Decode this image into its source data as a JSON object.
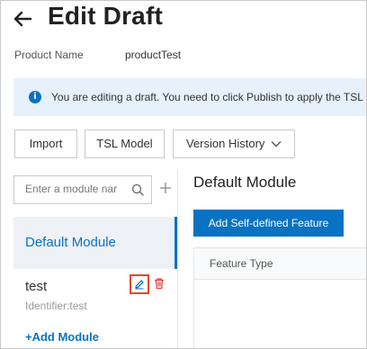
{
  "header": {
    "title": "Edit Draft",
    "back_icon": "arrow-left-icon"
  },
  "product": {
    "label": "Product Name",
    "value": "productTest"
  },
  "notice": {
    "icon": "info-icon",
    "icon_glyph": "i",
    "text": "You are editing a draft. You need to click Publish to apply the TSL m"
  },
  "toolbar": {
    "import_label": "Import",
    "tsl_model_label": "TSL Model",
    "version_history_label": "Version History"
  },
  "sidebar": {
    "search_placeholder": "Enter a module nar",
    "modules": [
      {
        "name": "Default Module",
        "selected": true
      },
      {
        "name": "test",
        "identifier": "Identifier:test"
      }
    ],
    "add_module_label": "+Add Module"
  },
  "main": {
    "title": "Default Module",
    "add_feature_label": "Add Self-defined Feature",
    "table_headers": [
      "Feature Type"
    ]
  },
  "colors": {
    "accent": "#0a72c3",
    "notice_bg": "#e7f1fb",
    "highlight": "#e8491d",
    "delete": "#e23a3a"
  }
}
